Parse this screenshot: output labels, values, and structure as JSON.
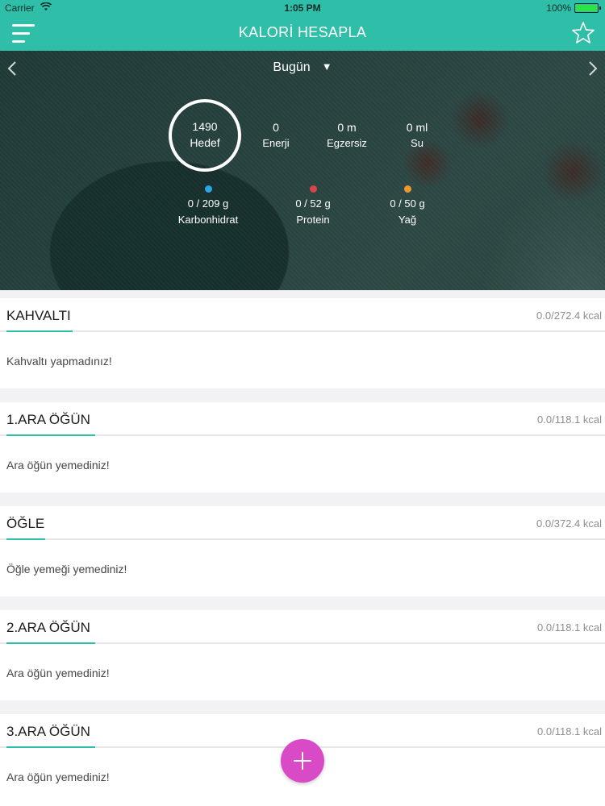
{
  "status_bar": {
    "carrier": "Carrier",
    "time": "1:05 PM",
    "battery": "100%"
  },
  "nav": {
    "title": "KALORİ HESAPLA"
  },
  "date": {
    "label": "Bugün"
  },
  "summary": {
    "goal": {
      "value": "1490",
      "label": "Hedef"
    },
    "stats": [
      {
        "value": "0",
        "label": "Enerji"
      },
      {
        "value": "0 m",
        "label": "Egzersiz"
      },
      {
        "value": "0 ml",
        "label": "Su"
      }
    ],
    "macros": [
      {
        "value": "0 / 209 g",
        "label": "Karbonhidrat",
        "color": "#2aa6e6"
      },
      {
        "value": "0 / 52 g",
        "label": "Protein",
        "color": "#d8434e"
      },
      {
        "value": "0 / 50 g",
        "label": "Yağ",
        "color": "#f0962e"
      }
    ]
  },
  "meals": [
    {
      "title": "KAHVALTI",
      "kcal": "0.0/272.4 kcal",
      "empty": "Kahvaltı yapmadınız!"
    },
    {
      "title": "1.ARA ÖĞÜN",
      "kcal": "0.0/118.1 kcal",
      "empty": "Ara öğün yemediniz!"
    },
    {
      "title": "ÖĞLE",
      "kcal": "0.0/372.4 kcal",
      "empty": "Öğle yemeği yemediniz!"
    },
    {
      "title": "2.ARA ÖĞÜN",
      "kcal": "0.0/118.1 kcal",
      "empty": "Ara öğün yemediniz!"
    },
    {
      "title": "3.ARA ÖĞÜN",
      "kcal": "0.0/118.1 kcal",
      "empty": "Ara öğün yemediniz!"
    }
  ],
  "colors": {
    "accent": "#2fbfa8",
    "fab": "#d94bc6"
  }
}
